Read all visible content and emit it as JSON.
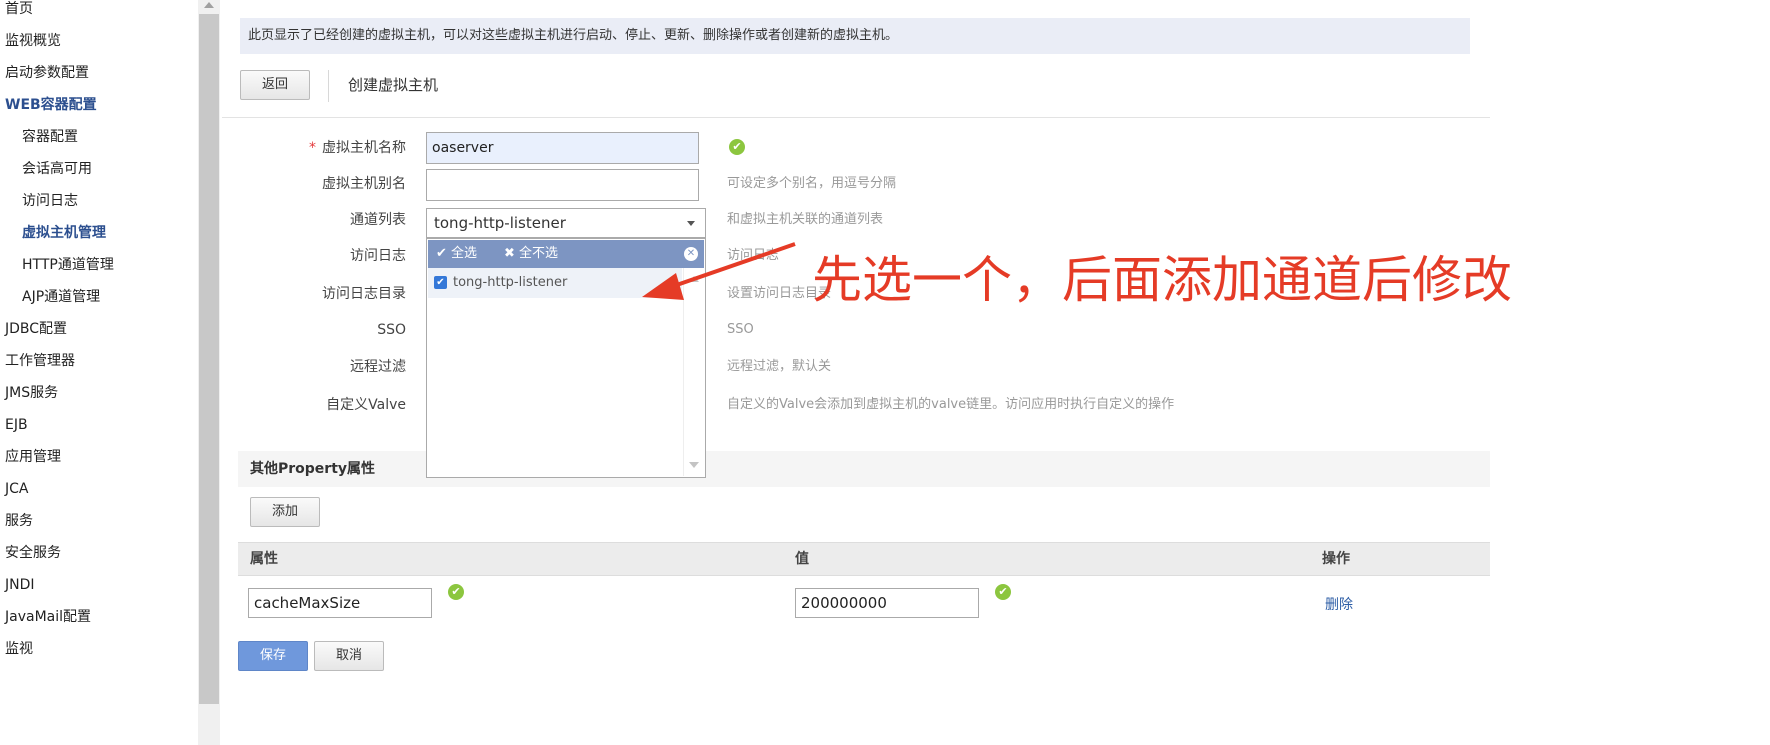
{
  "sidebar": {
    "items": [
      {
        "label": "首页",
        "level": 0
      },
      {
        "label": "监视概览",
        "level": 0
      },
      {
        "label": "启动参数配置",
        "level": 0
      },
      {
        "label": "WEB容器配置",
        "level": 0
      },
      {
        "label": "容器配置",
        "level": 1
      },
      {
        "label": "会话高可用",
        "level": 1
      },
      {
        "label": "访问日志",
        "level": 1
      },
      {
        "label": "虚拟主机管理",
        "level": 1
      },
      {
        "label": "HTTP通道管理",
        "level": 1
      },
      {
        "label": "AJP通道管理",
        "level": 1
      },
      {
        "label": "JDBC配置",
        "level": 0
      },
      {
        "label": "工作管理器",
        "level": 0
      },
      {
        "label": "JMS服务",
        "level": 0
      },
      {
        "label": "EJB",
        "level": 0
      },
      {
        "label": "应用管理",
        "level": 0
      },
      {
        "label": "JCA",
        "level": 0
      },
      {
        "label": "服务",
        "level": 0
      },
      {
        "label": "安全服务",
        "level": 0
      },
      {
        "label": "JNDI",
        "level": 0
      },
      {
        "label": "JavaMail配置",
        "level": 0
      },
      {
        "label": "监视",
        "level": 0
      }
    ]
  },
  "info": {
    "text": "此页显示了已经创建的虚拟主机，可以对这些虚拟主机进行启动、停止、更新、删除操作或者创建新的虚拟主机。"
  },
  "header": {
    "back_label": "返回",
    "title": "创建虚拟主机"
  },
  "form": {
    "required_mark": "*",
    "name_label": "虚拟主机名称",
    "name_value": "oaserver",
    "alias_label": "虚拟主机别名",
    "alias_value": "",
    "alias_hint": "可设定多个别名，用逗号分隔",
    "channel_label": "通道列表",
    "channel_value": "tong-http-listener",
    "channel_hint": "和虚拟主机关联的通道列表",
    "access_log_label": "访问日志",
    "access_log_hint": "访问日志",
    "log_dir_label": "访问日志目录",
    "log_dir_hint": "设置访问日志目录",
    "sso_label": "SSO",
    "sso_hint": "SSO",
    "remote_filter_label": "远程过滤",
    "remote_filter_hint": "远程过滤，默认关",
    "valve_label": "自定义Valve",
    "valve_hint": "自定义的Valve会添加到虚拟主机的valve链里。访问应用时执行自定义的操作"
  },
  "dropdown": {
    "select_all": "全选",
    "select_none": "全不选",
    "options": [
      {
        "label": "tong-http-listener",
        "checked": true
      }
    ]
  },
  "annotation": {
    "text": "先选一个，后面添加通道后修改",
    "color": "#e53b26"
  },
  "properties": {
    "section_title": "其他Property属性",
    "add_label": "添加",
    "columns": {
      "name": "属性",
      "value": "值",
      "action": "操作"
    },
    "rows": [
      {
        "name": "cacheMaxSize",
        "value": "200000000",
        "action": "删除"
      }
    ]
  },
  "footer": {
    "save_label": "保存",
    "cancel_label": "取消"
  },
  "colors": {
    "accent": "#6f98dc",
    "ok": "#8cc63f",
    "link": "#2c5da6"
  }
}
